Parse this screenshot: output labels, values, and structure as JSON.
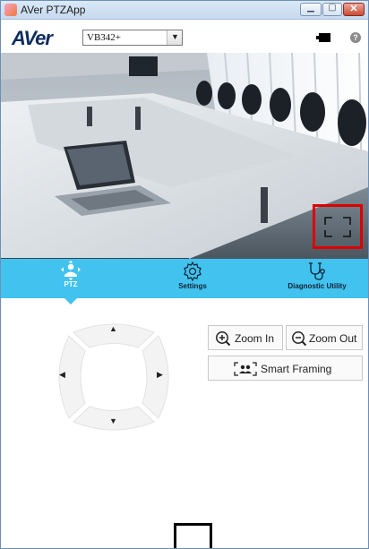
{
  "window": {
    "title": "AVer PTZApp"
  },
  "header": {
    "logo_text": "AVer",
    "camera_model": "VB342+",
    "help_glyph": "?"
  },
  "preview": {
    "scene": "conference room with laptop on table",
    "fullscreen_icon": "fullscreen-icon"
  },
  "tabs": [
    {
      "label": "PTZ",
      "icon": "ptz-icon",
      "active": true
    },
    {
      "label": "Settings",
      "icon": "gear-icon",
      "active": false
    },
    {
      "label": "Diagnostic Utility",
      "icon": "stethoscope-icon",
      "active": false
    }
  ],
  "ptz": {
    "up_glyph": "▲",
    "down_glyph": "▼",
    "left_glyph": "◀",
    "right_glyph": "▶",
    "zoom_in_label": "Zoom In",
    "zoom_out_label": "Zoom Out",
    "smart_framing_label": "Smart Framing"
  },
  "colors": {
    "tab_bar": "#41c2ef",
    "highlight": "#e00000",
    "logo": "#0d2c5e"
  }
}
